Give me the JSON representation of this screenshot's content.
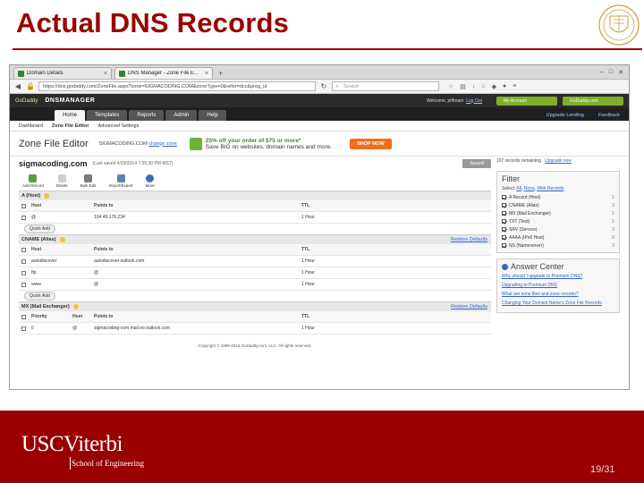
{
  "slide": {
    "title": "Actual DNS Records",
    "page_number": "19/31",
    "logo": {
      "org": "USC",
      "school": "Viterbi",
      "sub": "School of Engineering"
    },
    "accent_color": "#990000"
  },
  "browser": {
    "tabs": [
      {
        "label": "Domain Details",
        "active": false
      },
      {
        "label": "DNS Manager - Zone File E...",
        "active": true
      }
    ],
    "url": "https://dns.godaddy.com/ZoneFile.aspx?zone=SIGMACODING.COM&zoneType=0&refer=dcc&prog_id",
    "search_placeholder": "Search"
  },
  "gd": {
    "logo": "GoDaddy",
    "product": "DNSMANAGER",
    "welcome": "Welcome, jeffream",
    "logout": "Log Out",
    "my_account": "My Account",
    "godaddy_link": "GoDaddy.com",
    "menu": [
      "Home",
      "Templates",
      "Reports",
      "Admin",
      "Help"
    ],
    "active_menu": "Home",
    "side_links": [
      "Upgrade Lending",
      "Feedback"
    ],
    "crumbs": [
      "Dashboard",
      "Zone File Editor",
      "Advanced Settings"
    ],
    "active_crumb": "Zone File Editor"
  },
  "editor": {
    "title": "Zone File Editor",
    "domain_label": "SIGMACODING.COM",
    "change_zone": "change zone",
    "promo_line1": "25% off your order of $75 or more*",
    "promo_line2": "Save BIG on websites, domain names and more.",
    "shop_now": "SHOP NOW",
    "domain": "sigmacoding.com",
    "last_saved": "(Last saved 4/29/2014 7:55:30 PM MST)",
    "saved_btn": "Saved",
    "records_remaining": "107 records remaining.",
    "upgrade_now": "Upgrade now",
    "toolbar": [
      "Add Record",
      "Delete",
      "Bulk Edit",
      "Import/Export",
      "More"
    ],
    "copyright": "Copyright © 1999-2015 GoDaddy.com, LLC. All rights reserved."
  },
  "sections": {
    "a": {
      "title": "A (Host)",
      "cols": [
        "Host",
        "Points to",
        "TTL"
      ],
      "rows": [
        {
          "host": "@",
          "points": "104.49.170.234",
          "ttl": "1 Hour"
        }
      ],
      "quick_add": "Quick Add"
    },
    "cname": {
      "title": "CNAME (Alias)",
      "restore": "Restore Defaults",
      "cols": [
        "Host",
        "Points to",
        "TTL"
      ],
      "rows": [
        {
          "host": "autodiscover",
          "points": "autodiscover.outlook.com",
          "ttl": "1 Hour"
        },
        {
          "host": "ftp",
          "points": "@",
          "ttl": "1 Hour"
        },
        {
          "host": "www",
          "points": "@",
          "ttl": "1 Hour"
        }
      ],
      "quick_add": "Quick Add"
    },
    "mx": {
      "title": "MX (Mail Exchanger)",
      "restore": "Restore Defaults",
      "cols": [
        "Priority",
        "Host",
        "Points to",
        "TTL"
      ],
      "rows": [
        {
          "priority": "0",
          "host": "@",
          "points": "sigmacoding-com.mail.eo.outlook.com",
          "ttl": "1 Hour"
        }
      ]
    }
  },
  "filter": {
    "title": "Filter",
    "show": "Select:",
    "show_all": "All",
    "show_none": "None",
    "show_with": "With Records",
    "items": [
      {
        "label": "A Record (Host)",
        "count": "1"
      },
      {
        "label": "CNAME (Alias)",
        "count": "3"
      },
      {
        "label": "MX (Mail Exchanger)",
        "count": "1"
      },
      {
        "label": "TXT (Text)",
        "count": "1"
      },
      {
        "label": "SRV (Service)",
        "count": "2"
      },
      {
        "label": "AAAA (IPv6 Host)",
        "count": "0"
      },
      {
        "label": "NS (Nameserver)",
        "count": "2"
      }
    ]
  },
  "answers": {
    "title": "Answer Center",
    "items": [
      "Why should I upgrade to Premium DNS?",
      "Upgrading to Premium DNS",
      "What are zone files and zone records?",
      "Changing Your Domain Name's Zone File Records"
    ]
  }
}
